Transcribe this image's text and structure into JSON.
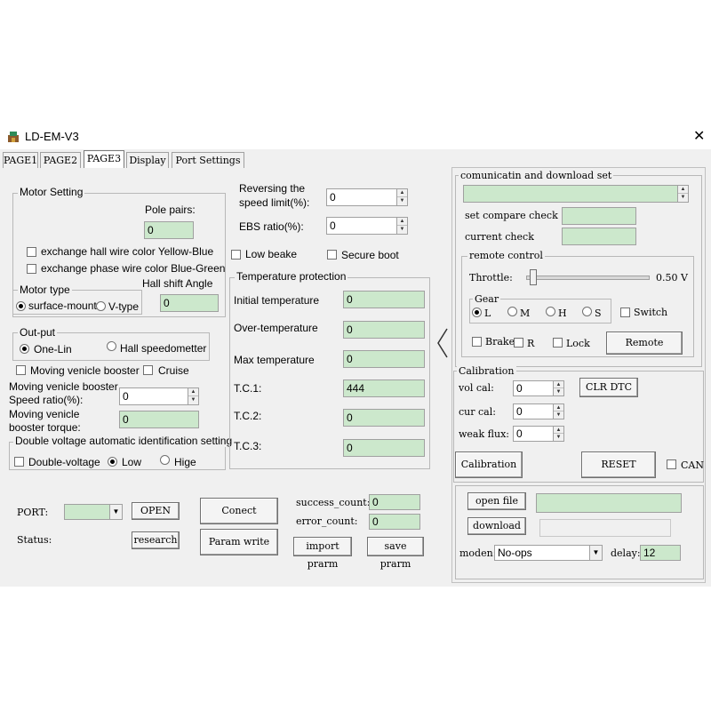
{
  "window": {
    "title": "LD-EM-V3",
    "close": "✕"
  },
  "tabs": [
    "PAGE1",
    "PAGE2",
    "PAGE3",
    "Display",
    "Port Settings"
  ],
  "motor_setting": {
    "title": "Motor Setting",
    "pole_pairs_label": "Pole pairs:",
    "pole_pairs_value": "0",
    "hall_color": "exchange hall wire color Yellow-Blue",
    "phase_color": "exchange phase wire color Blue-Green",
    "hall_shift_label": "Hall shift Angle",
    "hall_shift_value": "0",
    "motor_type_title": "Motor type",
    "surface_mount": "surface-mount",
    "v_type": "V-type"
  },
  "output": {
    "title": "Out-put",
    "one_lin": "One-Lin",
    "hall_speedometer": "Hall speedometter",
    "booster": "Moving venicle booster",
    "cruise": "Cruise",
    "speed_ratio_label1": "Moving venicle booster",
    "speed_ratio_label2": "Speed ratio(%):",
    "speed_ratio_value": "0",
    "torque_label1": "Moving venicle",
    "torque_label2": "booster torque:",
    "torque_value": "0"
  },
  "double_voltage": {
    "title": "Double voltage automatic identification setting",
    "double": "Double-voltage",
    "low": "Low",
    "high": "Hige"
  },
  "reverse": {
    "label1": "Reversing the",
    "label2": "speed limit(%):",
    "value": "0",
    "ebs_label": "EBS ratio(%):",
    "ebs_value": "0",
    "low_brake": "Low beake",
    "secure_boot": "Secure boot"
  },
  "temperature": {
    "title": "Temperature protection",
    "rows": [
      {
        "label": "Initial temperature",
        "value": "0"
      },
      {
        "label": "Over-temperature",
        "value": "0"
      },
      {
        "label": "Max temperature",
        "value": "0"
      },
      {
        "label": "T.C.1:",
        "value": "444"
      },
      {
        "label": "T.C.2:",
        "value": "0"
      },
      {
        "label": "T.C.3:",
        "value": "0"
      }
    ]
  },
  "port": {
    "port_label": "PORT:",
    "open": "OPEN",
    "connect": "Conect",
    "status_label": "Status:",
    "research": "research",
    "param_write": "Param write",
    "success_label": "success_count:",
    "success_value": "0",
    "error_label": "error_count:",
    "error_value": "0",
    "import": "import prarm",
    "save": "save prarm"
  },
  "comm": {
    "title": "comunicatin and download set",
    "set_compare": "set compare check",
    "current_check": "current check"
  },
  "remote": {
    "title": "remote control",
    "throttle": "Throttle:",
    "throttle_value": "0.50 V",
    "throttle_level": 0.02,
    "gear_title": "Gear",
    "gears": [
      "L",
      "M",
      "H",
      "S"
    ],
    "switch": "Switch",
    "brake": "Brake",
    "r": "R",
    "lock": "Lock",
    "remote_btn": "Remote"
  },
  "calibration": {
    "title": "Calibration",
    "vol_cal": "vol cal:",
    "vol_cal_value": "0",
    "clr_dtc": "CLR DTC",
    "cur_cal": "cur cal:",
    "cur_cal_value": "0",
    "weak_flux": "weak flux:",
    "weak_flux_value": "0",
    "calibration_btn": "Calibration",
    "reset": "RESET",
    "can": "CAN"
  },
  "download": {
    "open_file": "open file",
    "download": "download",
    "moden_label": "moden:",
    "moden_value": "No-ops",
    "delay_label": "delay:",
    "delay_value": "12"
  }
}
